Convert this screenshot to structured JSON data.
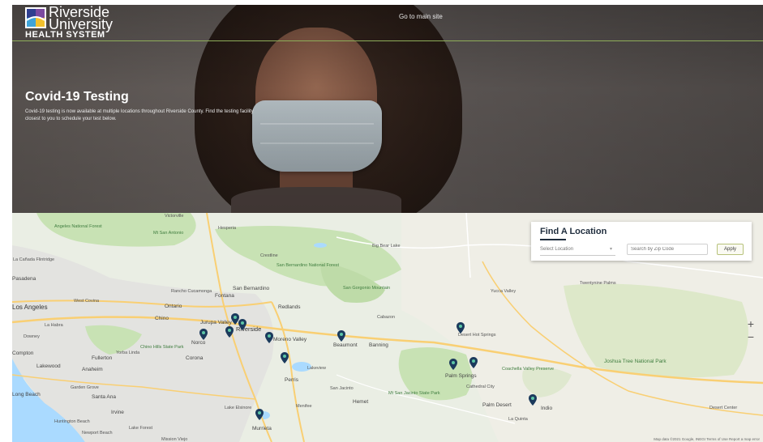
{
  "header": {
    "logo_line1": "Riverside",
    "logo_line2": "University",
    "logo_line3": "HEALTH SYSTEM",
    "main_site_link": "Go to main site"
  },
  "hero": {
    "title": "Covid-19 Testing",
    "text": "Covid-19 testing is now available at multiple locations throughout Riverside County. Find the testing facility closest to you to schedule your test below."
  },
  "finder": {
    "title": "Find A Location",
    "select_value": "Select Location",
    "zip_placeholder": "Search by Zip Code",
    "apply_label": "Apply"
  },
  "map": {
    "zoom_in": "+",
    "zoom_out": "−",
    "attribution": "Map data ©2021 Google, INEGI   Terms of Use   Report a map error",
    "labels": {
      "angeles_forest": "Angeles National Forest",
      "la_canada": "La Cañada Flintridge",
      "pasadena": "Pasadena",
      "los_angeles": "Los Angeles",
      "west_covina": "West Covina",
      "ontario": "Ontario",
      "chino": "Chino",
      "fontana": "Fontana",
      "san_bernardino": "San Bernardino",
      "redlands": "Redlands",
      "rancho": "Rancho Cucamonga",
      "riverside": "Riverside",
      "jurupa": "Jurupa Valley",
      "norco": "Norco",
      "corona": "Corona",
      "moreno": "Moreno Valley",
      "perris": "Perris",
      "lakeview": "Lakeview",
      "beaumont": "Beaumont",
      "banning": "Banning",
      "cabazon": "Cabazon",
      "yucca": "Yucca Valley",
      "desert_hot": "Desert Hot Springs",
      "palm_springs": "Palm Springs",
      "cathedral": "Cathedral City",
      "palm_desert": "Palm Desert",
      "indio": "Indio",
      "coachella": "Coachella Valley Preserve",
      "joshua": "Joshua Tree National Park",
      "twentynine": "Twentynine Palms",
      "sbnf": "San Bernardino National Forest",
      "san_jacinto": "San Jacinto",
      "hemet": "Hemet",
      "menifee": "Menifee",
      "lake_elsinore": "Lake Elsinore",
      "murrieta": "Murrieta",
      "anaheim": "Anaheim",
      "santa_ana": "Santa Ana",
      "irvine": "Irvine",
      "long_beach": "Long Beach",
      "huntington": "Huntington Beach",
      "newport": "Newport Beach",
      "lake_forest": "Lake Forest",
      "mission_viejo": "Mission Viejo",
      "fullerton": "Fullerton",
      "yorba": "Yorba Linda",
      "compton": "Compton",
      "downey": "Downey",
      "lakewood": "Lakewood",
      "garden_grove": "Garden Grove",
      "mt_san_jacinto": "Mt San Jacinto State Park",
      "desert_center": "Desert Center",
      "chino_hills": "Chino Hills State Park",
      "mt_baldy": "Mt San Antonio",
      "big_bear": "Big Bear Lake",
      "crestline": "Crestline",
      "hesperia": "Hesperia",
      "victorville": "Victorville",
      "la_quinta": "La Quinta",
      "san_gorgonio": "San Gorgonio Mountain",
      "la_habra": "La Habra"
    }
  },
  "colors": {
    "accent_green": "#8fae5a",
    "pin_blue": "#1b3a5c",
    "finder_title": "#1f2d3d"
  }
}
